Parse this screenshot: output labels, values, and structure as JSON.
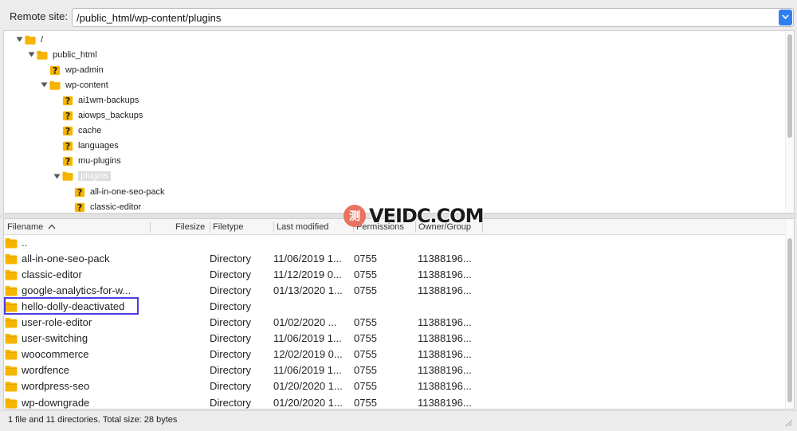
{
  "remote_site": {
    "label": "Remote site:",
    "path": "/public_html/wp-content/plugins"
  },
  "tree": [
    {
      "label": "/",
      "icon": "folder-icon",
      "expanded": true,
      "depth": 0
    },
    {
      "label": "public_html",
      "icon": "folder-icon",
      "expanded": true,
      "depth": 1
    },
    {
      "label": "wp-admin",
      "icon": "unknown-folder-icon",
      "depth": 2
    },
    {
      "label": "wp-content",
      "icon": "folder-icon",
      "expanded": true,
      "depth": 2
    },
    {
      "label": "ai1wm-backups",
      "icon": "unknown-folder-icon",
      "depth": 3
    },
    {
      "label": "aiowps_backups",
      "icon": "unknown-folder-icon",
      "depth": 3
    },
    {
      "label": "cache",
      "icon": "unknown-folder-icon",
      "depth": 3
    },
    {
      "label": "languages",
      "icon": "unknown-folder-icon",
      "depth": 3
    },
    {
      "label": "mu-plugins",
      "icon": "unknown-folder-icon",
      "depth": 3
    },
    {
      "label": "plugins",
      "icon": "folder-icon",
      "expanded": true,
      "selected": true,
      "depth": 3
    },
    {
      "label": "all-in-one-seo-pack",
      "icon": "unknown-folder-icon",
      "depth": 4
    },
    {
      "label": "classic-editor",
      "icon": "unknown-folder-icon",
      "depth": 4
    }
  ],
  "columns": {
    "filename": "Filename",
    "filesize": "Filesize",
    "filetype": "Filetype",
    "last_modified": "Last modified",
    "permissions": "Permissions",
    "owner_group": "Owner/Group"
  },
  "files": [
    {
      "name": "..",
      "type": "",
      "modified": "",
      "perms": "",
      "owner": ""
    },
    {
      "name": "all-in-one-seo-pack",
      "type": "Directory",
      "modified": "11/06/2019 1...",
      "perms": "0755",
      "owner": "11388196..."
    },
    {
      "name": "classic-editor",
      "type": "Directory",
      "modified": "11/12/2019 0...",
      "perms": "0755",
      "owner": "11388196..."
    },
    {
      "name": "google-analytics-for-w...",
      "type": "Directory",
      "modified": "01/13/2020 1...",
      "perms": "0755",
      "owner": "11388196..."
    },
    {
      "name": "hello-dolly-deactivated",
      "type": "Directory",
      "modified": "",
      "perms": "",
      "owner": "",
      "highlighted": true
    },
    {
      "name": "user-role-editor",
      "type": "Directory",
      "modified": "01/02/2020 ...",
      "perms": "0755",
      "owner": "11388196..."
    },
    {
      "name": "user-switching",
      "type": "Directory",
      "modified": "11/06/2019 1...",
      "perms": "0755",
      "owner": "11388196..."
    },
    {
      "name": "woocommerce",
      "type": "Directory",
      "modified": "12/02/2019 0...",
      "perms": "0755",
      "owner": "11388196..."
    },
    {
      "name": "wordfence",
      "type": "Directory",
      "modified": "11/06/2019 1...",
      "perms": "0755",
      "owner": "11388196..."
    },
    {
      "name": "wordpress-seo",
      "type": "Directory",
      "modified": "01/20/2020 1...",
      "perms": "0755",
      "owner": "11388196..."
    },
    {
      "name": "wp-downgrade",
      "type": "Directory",
      "modified": "01/20/2020 1...",
      "perms": "0755",
      "owner": "11388196..."
    }
  ],
  "status": "1 file and 11 directories. Total size: 28 bytes",
  "watermark": {
    "badge": "测",
    "text": "VEIDC.COM"
  },
  "colors": {
    "folder": "#f7b500",
    "highlight_border": "#4d3de0",
    "dropdown_accent": "#2f7ff0",
    "watermark_badge": "#e8735e"
  }
}
